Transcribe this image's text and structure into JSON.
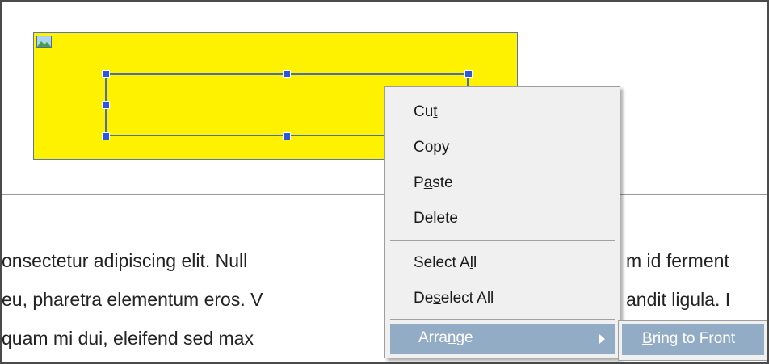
{
  "document": {
    "text_lines": [
      "onsectetur adipiscing elit. Null",
      "m id ferment",
      "eu, pharetra elementum eros. V",
      "andit ligula. I",
      "quam mi dui, eleifend sed max"
    ],
    "image_fill_color": "#fff200",
    "image_icon": "image-icon"
  },
  "context_menu": {
    "items": [
      {
        "label": "Cut",
        "mnemonic": "t"
      },
      {
        "label": "Copy",
        "mnemonic": "C"
      },
      {
        "label": "Paste",
        "mnemonic": "a"
      },
      {
        "label": "Delete",
        "mnemonic": "D"
      },
      {
        "label": "Select All",
        "mnemonic": "l"
      },
      {
        "label": "Deselect All",
        "mnemonic": "s"
      }
    ],
    "arrange": {
      "label": "Arrange",
      "mnemonic": "n",
      "highlighted": true
    },
    "highlight_color": "#93acc6"
  },
  "submenu": {
    "items": [
      {
        "label": "Bring to Front",
        "mnemonic": "B",
        "highlighted": true
      }
    ]
  }
}
